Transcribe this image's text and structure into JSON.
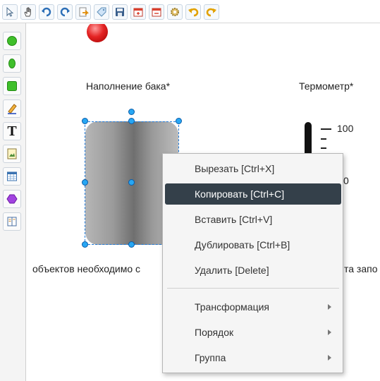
{
  "toolbar": {
    "icons": [
      "pointer-icon",
      "hand-icon",
      "undo-arrow-icon",
      "redo-arrow-icon",
      "import-icon",
      "tag-icon",
      "save-icon",
      "calendar-add-icon",
      "calendar-remove-icon",
      "settings-gear-icon",
      "undo-icon",
      "redo-icon"
    ]
  },
  "palette": {
    "icons": [
      "circle-shape-icon",
      "ellipse-shape-icon",
      "rectangle-shape-icon",
      "pencil-icon",
      "text-icon",
      "image-icon",
      "table-icon",
      "polygon-icon",
      "book-icon"
    ],
    "text_tool_glyph": "T"
  },
  "canvas": {
    "tank_label": "Наполнение бака*",
    "thermometer_label": "Термометр*",
    "thermo_max": "100",
    "thermo_mid": "0",
    "footer_left": "объектов необходимо с",
    "footer_right": "та запо"
  },
  "context_menu": {
    "items": [
      {
        "label": "Вырезать [Ctrl+X]"
      },
      {
        "label": "Копировать [Ctrl+C]",
        "active": true
      },
      {
        "label": "Вставить [Ctrl+V]"
      },
      {
        "label": "Дублировать [Ctrl+B]"
      },
      {
        "label": "Удалить [Delete]"
      }
    ],
    "submenus": [
      {
        "label": "Трансформация"
      },
      {
        "label": "Порядок"
      },
      {
        "label": "Группа"
      }
    ]
  },
  "colors": {
    "accent": "#27a7f4",
    "menu_highlight": "#34404a",
    "indicator_red": "#e42323"
  }
}
